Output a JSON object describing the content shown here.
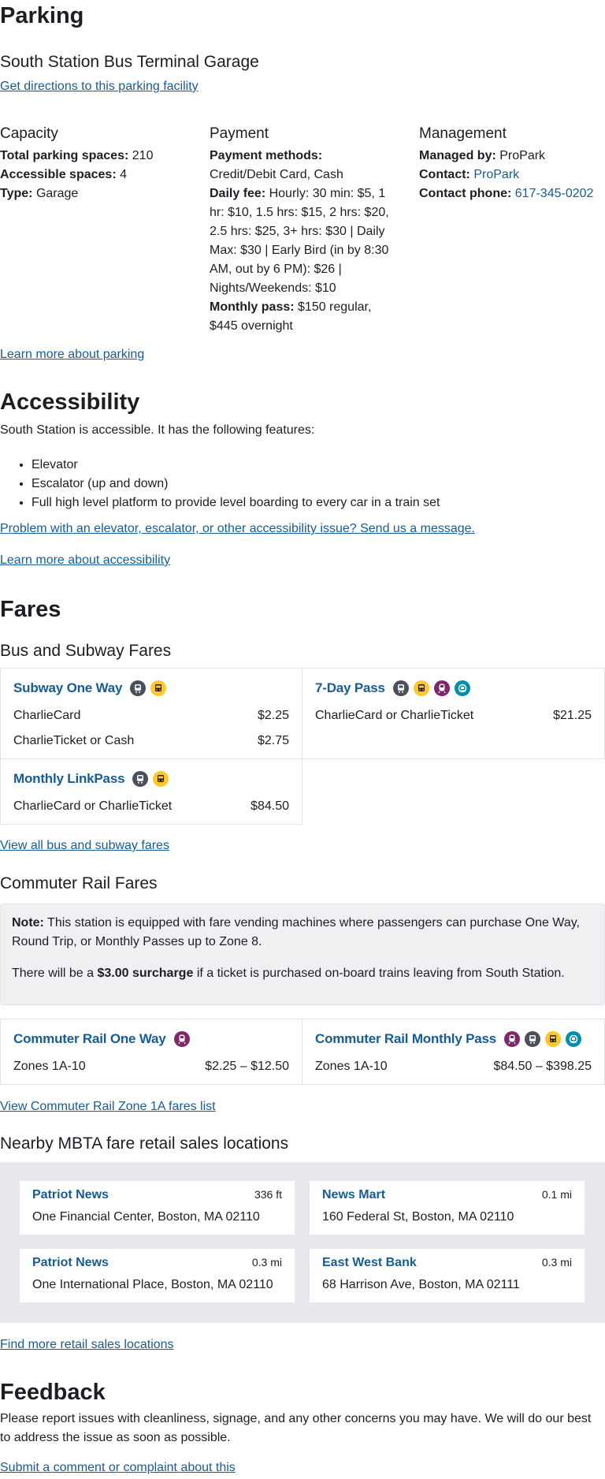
{
  "parking": {
    "heading": "Parking",
    "facility_name": "South Station Bus Terminal Garage",
    "directions_link": "Get directions to this parking facility",
    "capacity": {
      "title": "Capacity",
      "total_label": "Total parking spaces:",
      "total_value": "210",
      "accessible_label": "Accessible spaces:",
      "accessible_value": "4",
      "type_label": "Type:",
      "type_value": "Garage"
    },
    "payment": {
      "title": "Payment",
      "methods_label": "Payment methods:",
      "methods_value": "Credit/Debit Card, Cash",
      "daily_label": "Daily fee:",
      "daily_value": "Hourly: 30 min: $5, 1 hr: $10, 1.5 hrs: $15, 2 hrs: $20, 2.5 hrs: $25, 3+ hrs: $30 | Daily Max: $30 | Early Bird (in by 8:30 AM, out by 6 PM): $26 | Nights/Weekends: $10",
      "monthly_label": "Monthly pass:",
      "monthly_value": "$150 regular, $445 overnight"
    },
    "management": {
      "title": "Management",
      "managed_label": "Managed by:",
      "managed_value": "ProPark",
      "contact_label": "Contact:",
      "contact_value": "ProPark",
      "phone_label": "Contact phone:",
      "phone_value": "617-345-0202"
    },
    "learn_more_link": "Learn more about parking"
  },
  "accessibility": {
    "heading": "Accessibility",
    "intro": "South Station is accessible. It has the following features:",
    "features": [
      "Elevator",
      "Escalator (up and down)",
      "Full high level platform to provide level boarding to every car in a train set"
    ],
    "problem_link": "Problem with an elevator, escalator, or other accessibility issue? Send us a message.",
    "learn_more_link": "Learn more about accessibility"
  },
  "fares": {
    "heading": "Fares",
    "bus_subway": {
      "title": "Bus and Subway Fares",
      "cards": [
        {
          "title": "Subway One Way",
          "rows": [
            {
              "label": "CharlieCard",
              "price": "$2.25"
            },
            {
              "label": "CharlieTicket or Cash",
              "price": "$2.75"
            }
          ]
        },
        {
          "title": "7-Day Pass",
          "rows": [
            {
              "label": "CharlieCard or CharlieTicket",
              "price": "$21.25"
            }
          ]
        },
        {
          "title": "Monthly LinkPass",
          "rows": [
            {
              "label": "CharlieCard or CharlieTicket",
              "price": "$84.50"
            }
          ]
        }
      ],
      "view_all_link": "View all bus and subway fares"
    },
    "commuter_rail": {
      "title": "Commuter Rail Fares",
      "note_label": "Note:",
      "note_text": "This station is equipped with fare vending machines where passengers can purchase One Way, Round Trip, or Monthly Passes up to Zone 8.",
      "surcharge_pre": "There will be a",
      "surcharge_bold": "$3.00 surcharge",
      "surcharge_post": "if a ticket is purchased on-board trains leaving from South Station.",
      "cards": [
        {
          "title": "Commuter Rail One Way",
          "zone": "Zones 1A-10",
          "price": "$2.25 – $12.50"
        },
        {
          "title": "Commuter Rail Monthly Pass",
          "zone": "Zones 1A-10",
          "price": "$84.50 – $398.25"
        }
      ],
      "view_link": "View Commuter Rail Zone 1A fares list"
    },
    "retail": {
      "title": "Nearby MBTA fare retail sales locations",
      "locations": [
        {
          "name": "Patriot News",
          "distance": "336 ft",
          "address": "One Financial Center, Boston, MA 02110"
        },
        {
          "name": "News Mart",
          "distance": "0.1 mi",
          "address": "160 Federal St, Boston, MA 02110"
        },
        {
          "name": "Patriot News",
          "distance": "0.3 mi",
          "address": "One International Place, Boston, MA 02110"
        },
        {
          "name": "East West Bank",
          "distance": "0.3 mi",
          "address": "68 Harrison Ave, Boston, MA 02111"
        }
      ],
      "find_more_link": "Find more retail sales locations"
    }
  },
  "feedback": {
    "heading": "Feedback",
    "text": "Please report issues with cleanliness, signage, and any other concerns you may have. We will do our best to address the issue as soon as possible.",
    "submit_link": "Submit a comment or complaint about this"
  },
  "colors": {
    "link": "#165c96",
    "subway_mode": "#494f5c",
    "bus_mode": "#ffc72c",
    "commuter_rail_mode": "#80276c",
    "ferry_mode": "#008eaa"
  },
  "icons": {
    "subway": "subway-icon",
    "bus": "bus-icon",
    "commuter_rail": "commuter-rail-icon",
    "ferry": "ferry-icon"
  }
}
